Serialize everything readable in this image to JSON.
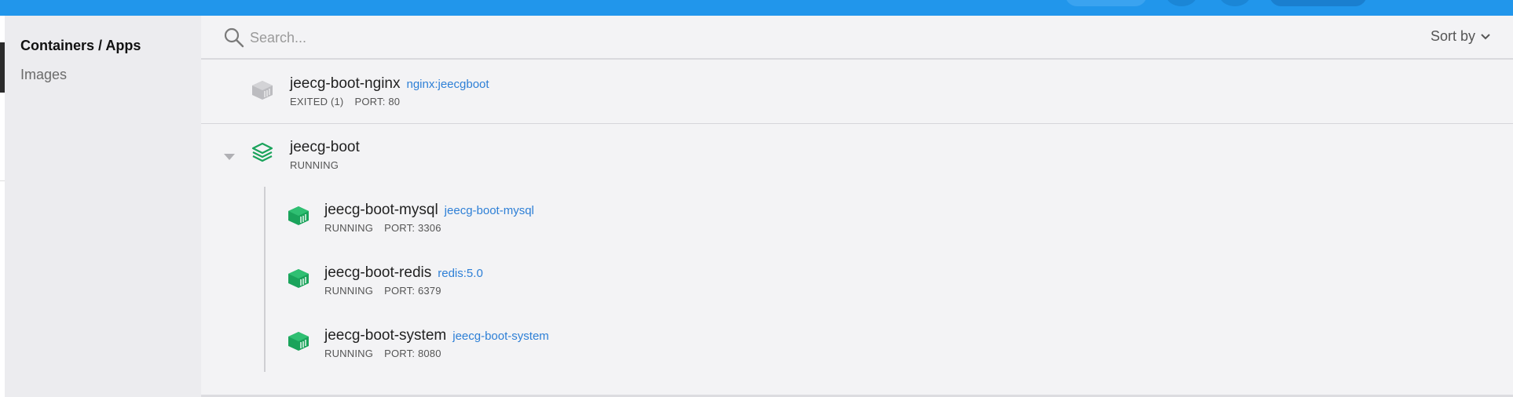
{
  "sidebar": {
    "items": [
      {
        "label": "Containers / Apps",
        "active": true
      },
      {
        "label": "Images",
        "active": false
      }
    ]
  },
  "search": {
    "placeholder": "Search..."
  },
  "sort": {
    "label": "Sort by"
  },
  "containers": [
    {
      "name": "jeecg-boot-nginx",
      "image": "nginx:jeecgboot",
      "status": "EXITED (1)",
      "port": "PORT: 80",
      "icon": "container-stopped-icon"
    },
    {
      "name": "jeecg-boot",
      "status": "RUNNING",
      "icon": "app-stack-icon",
      "children": [
        {
          "name": "jeecg-boot-mysql",
          "image": "jeecg-boot-mysql",
          "status": "RUNNING",
          "port": "PORT: 3306",
          "icon": "container-running-icon"
        },
        {
          "name": "jeecg-boot-redis",
          "image": "redis:5.0",
          "status": "RUNNING",
          "port": "PORT: 6379",
          "icon": "container-running-icon"
        },
        {
          "name": "jeecg-boot-system",
          "image": "jeecg-boot-system",
          "status": "RUNNING",
          "port": "PORT: 8080",
          "icon": "container-running-icon"
        }
      ]
    }
  ],
  "colors": {
    "topbar": "#2196eb",
    "running": "#1aa35b",
    "stopped": "#b8b8bc",
    "link": "#2d7fd6"
  }
}
